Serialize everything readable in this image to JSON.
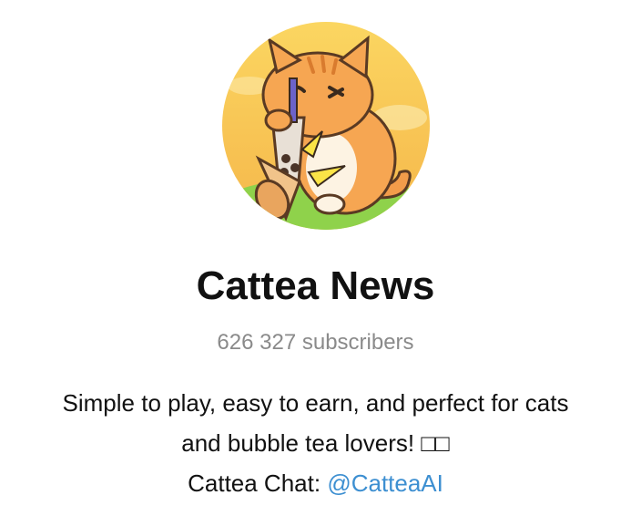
{
  "channel": {
    "name": "Cattea News",
    "subscribers": "626 327 subscribers",
    "avatar_icon": "cat-drinking-bubble-tea-avatar",
    "description": {
      "line1": "Simple to play, easy to earn, and perfect for cats",
      "line2": "and bubble tea lovers! □□",
      "chat_label": "Cattea Chat: ",
      "chat_link": "@CatteaAI"
    }
  },
  "colors": {
    "link": "#3d8fd1",
    "subscribers": "#8a8a8a",
    "avatar_background": "#f8cf5c"
  }
}
